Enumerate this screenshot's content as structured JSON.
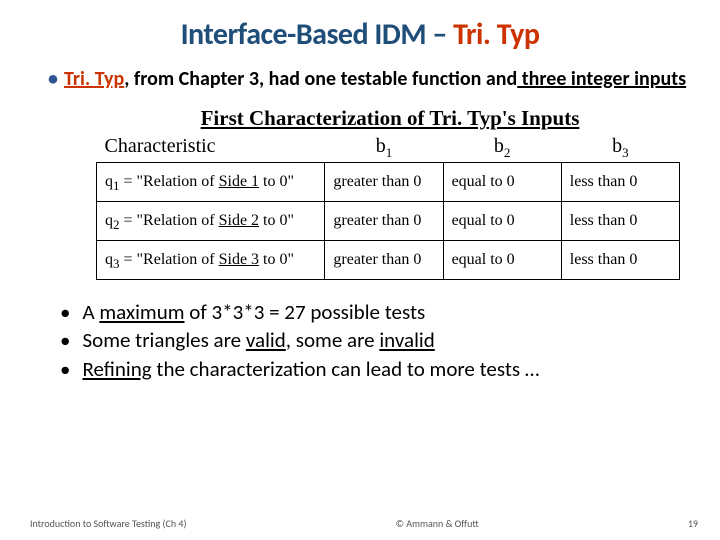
{
  "title_prefix": "Interface-Based IDM – ",
  "title_highlight": "Tri. Typ",
  "lead": {
    "prefix": "Tri. Typ",
    "mid": ", from Chapter 3, had one testable function and",
    "count": " three integer inputs"
  },
  "table": {
    "caption": "First Characterization of Tri. Typ's Inputs",
    "head": {
      "c": "Characteristic",
      "b1": "b",
      "b2": "b",
      "b3": "b"
    },
    "rows": [
      {
        "q": "q",
        "qi": "1",
        "rel": " = \"Relation of ",
        "side": "Side 1",
        "to": " to 0\"",
        "b1": "greater than 0",
        "b2": "equal to 0",
        "b3": "less than 0"
      },
      {
        "q": "q",
        "qi": "2",
        "rel": " = \"Relation of ",
        "side": "Side 2",
        "to": " to 0\"",
        "b1": "greater than 0",
        "b2": "equal to 0",
        "b3": "less than 0"
      },
      {
        "q": "q",
        "qi": "3",
        "rel": " = \"Relation of ",
        "side": "Side 3",
        "to": " to 0\"",
        "b1": "greater than 0",
        "b2": "equal to 0",
        "b3": "less than 0"
      }
    ]
  },
  "bullets": {
    "a_pre": "A ",
    "a_u": "maximum",
    "a_post": " of 3*3*3 = 27 possible tests",
    "b_pre": "Some triangles are ",
    "b_u1": "valid",
    "b_mid": ", some are ",
    "b_u2": "invalid",
    "c_pre": "",
    "c_u": "Refining",
    "c_post": " the characterization can lead to more tests …"
  },
  "footer": {
    "left": "Introduction to Software Testing (Ch 4)",
    "center": "© Ammann & Offutt",
    "right": "19"
  }
}
